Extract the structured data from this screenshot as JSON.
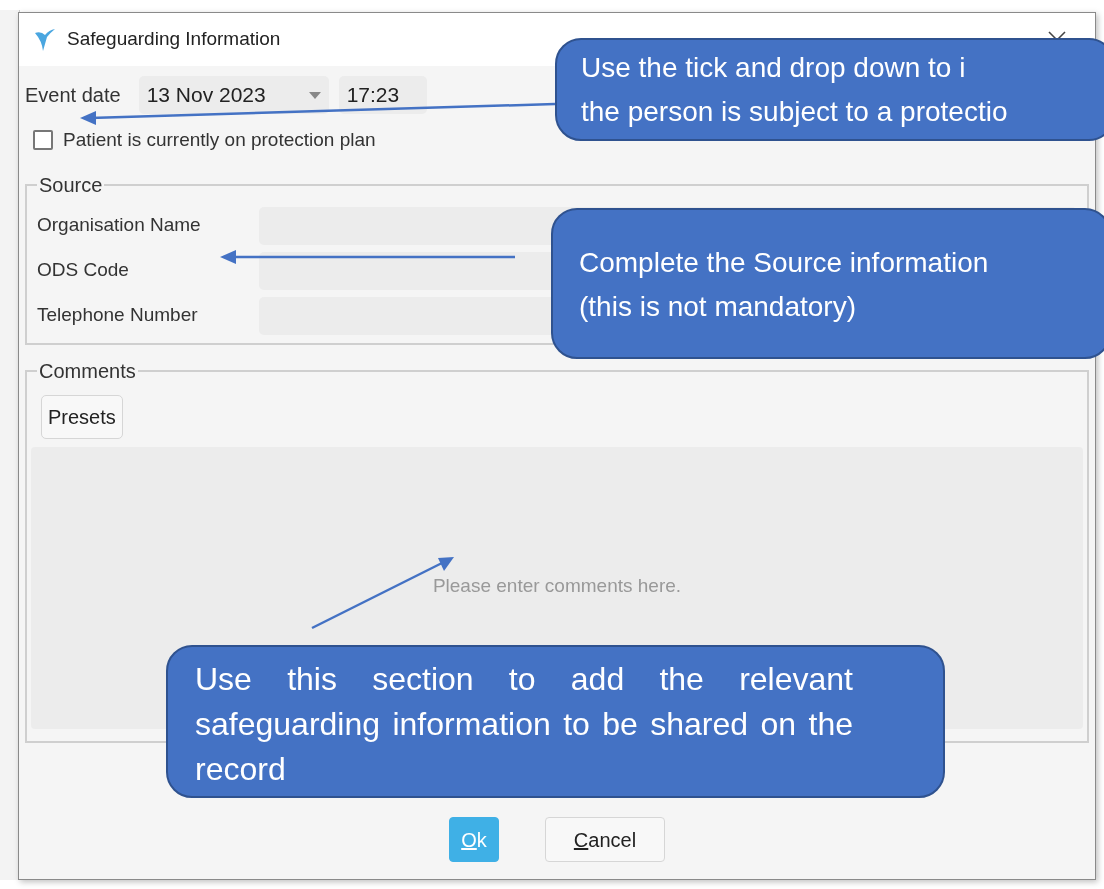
{
  "window": {
    "title": "Safeguarding Information"
  },
  "event_date": {
    "label": "Event date",
    "date": "13 Nov 2023",
    "time": "17:23"
  },
  "protection_plan": {
    "label": "Patient is currently on protection plan",
    "checked": false
  },
  "source": {
    "legend": "Source",
    "fields": [
      {
        "label": "Organisation Name"
      },
      {
        "label": "ODS Code"
      },
      {
        "label": "Telephone Number"
      }
    ]
  },
  "comments": {
    "legend": "Comments",
    "presets_button": "Presets",
    "placeholder": "Please enter comments here."
  },
  "buttons": [
    {
      "label": "Ok",
      "primary": true,
      "underline_first": true
    },
    {
      "label": "Cancel",
      "primary": false,
      "underline_first": true
    }
  ],
  "callouts": [
    {
      "kind": "top",
      "lines": [
        "Use the tick and drop down to i",
        "the person is subject to a protectio"
      ]
    },
    {
      "kind": "source",
      "lines": [
        "Complete the Source information",
        "(this is not mandatory)"
      ]
    },
    {
      "kind": "comments",
      "lines": [
        "Use this section to add the relevant safeguarding information to be shared on the record"
      ]
    }
  ]
}
